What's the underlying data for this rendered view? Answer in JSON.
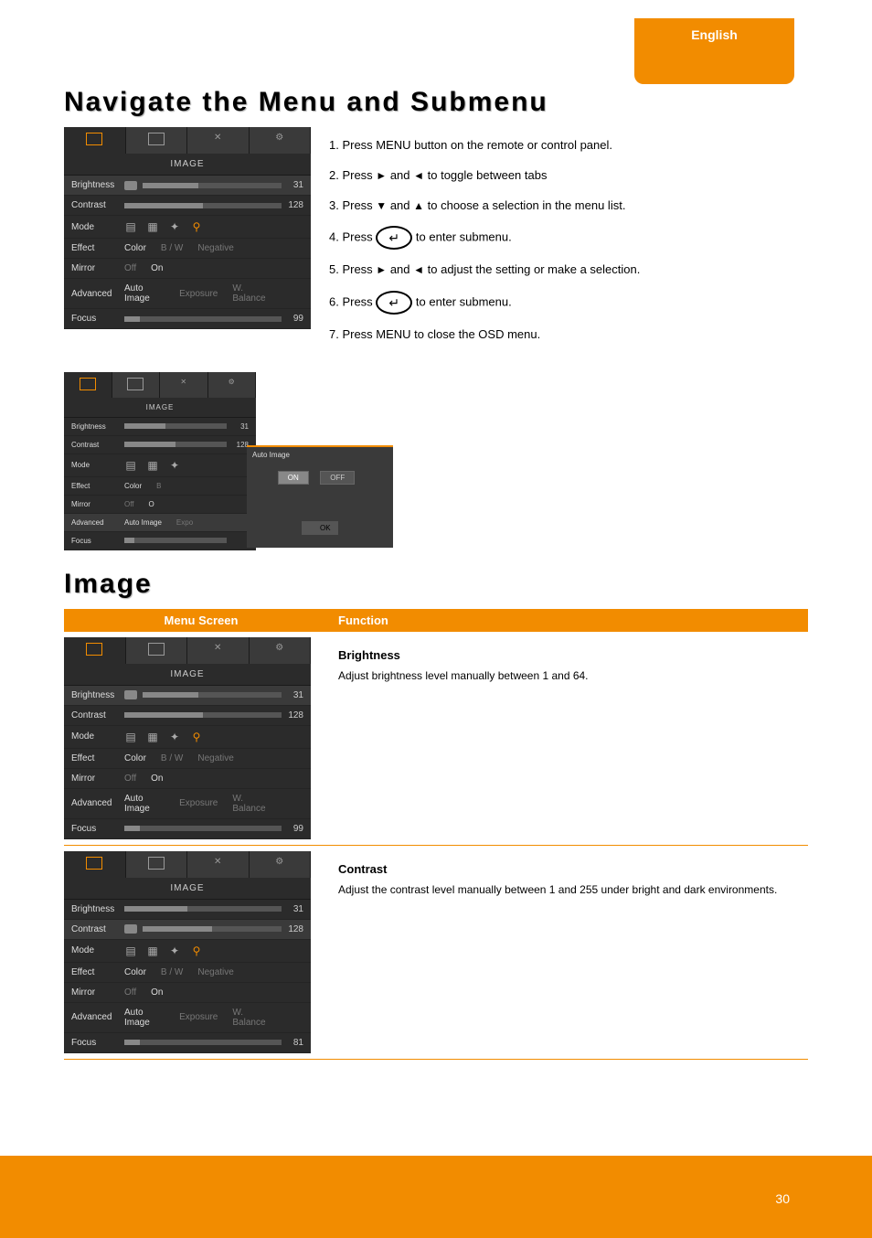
{
  "page": {
    "tab_label": "English",
    "number": "30"
  },
  "headings": {
    "navigate": "Navigate the Menu and Submenu",
    "image": "Image"
  },
  "steps": {
    "s1": "1. Press MENU button on the remote or control panel.",
    "s2a": "2. Press ",
    "s2b": " and ",
    "s2c": " to toggle between tabs",
    "s3a": "3. Press ",
    "s3b": " and ",
    "s3c": " to choose a selection in the menu list.",
    "s4a": "4. Press ",
    "s4b": " to enter submenu.",
    "s5a": "5. Press ",
    "s5b": " and ",
    "s5c": " to adjust the setting or make a selection.",
    "s6a": "6. Press ",
    "s6b": " to enter submenu.",
    "s7": "7. Press MENU to close the OSD menu."
  },
  "osd": {
    "title": "IMAGE",
    "rows": {
      "brightness": "Brightness",
      "contrast": "Contrast",
      "mode": "Mode",
      "effect": "Effect",
      "mirror": "Mirror",
      "advanced": "Advanced",
      "focus": "Focus"
    },
    "vals": {
      "brightness": "31",
      "contrast": "128",
      "focus": "99",
      "focus2": "81"
    },
    "effect": {
      "color": "Color",
      "bw": "B / W",
      "neg": "Negative"
    },
    "mirror": {
      "off": "Off",
      "on": "On"
    },
    "advanced": {
      "auto": "Auto Image",
      "exp": "Exposure",
      "wb": "W. Balance"
    },
    "submenu": {
      "title": "Auto Image",
      "on": "ON",
      "off": "OFF",
      "ok": "OK"
    }
  },
  "table": {
    "col1": "Menu Screen",
    "col2": "Function",
    "r1": {
      "label": "Brightness",
      "desc": "Adjust brightness level manually between 1 and 64."
    },
    "r2": {
      "label": "Contrast",
      "desc": "Adjust the contrast level manually between 1 and 255 under bright and dark environments."
    }
  }
}
